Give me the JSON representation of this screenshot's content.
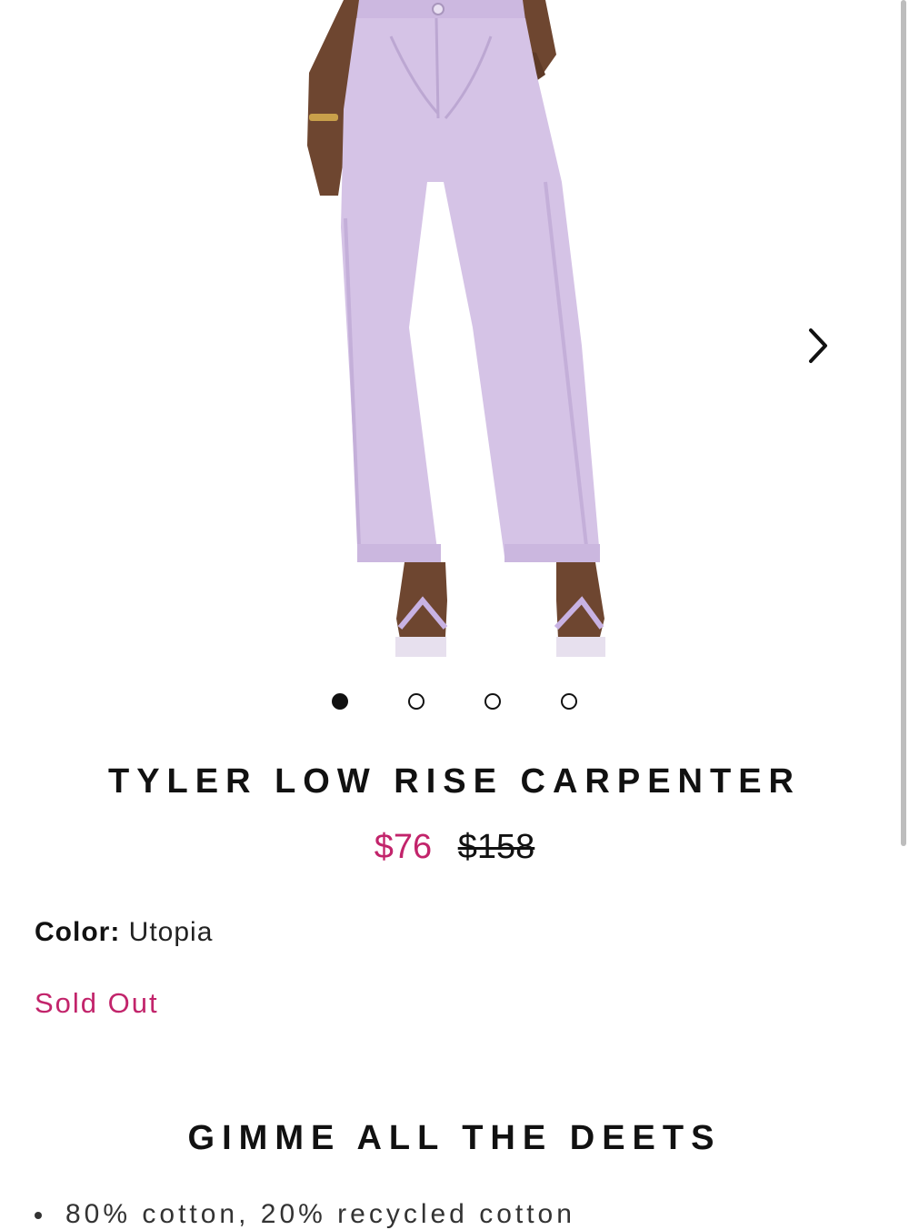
{
  "product": {
    "title": "TYLER LOW RISE CARPENTER",
    "sale_price": "$76",
    "original_price": "$158",
    "color_label": "Color:",
    "color_value": "Utopia",
    "availability": "Sold Out"
  },
  "gallery": {
    "current_index": 1,
    "total_images": 4,
    "next_icon": "chevron-right-icon"
  },
  "details": {
    "heading": "GIMME ALL THE DEETS",
    "bullets": [
      "80% cotton, 20% recycled cotton"
    ]
  },
  "colors": {
    "accent": "#c2246b",
    "text": "#111111",
    "product_lavender": "#d5c3e6"
  }
}
